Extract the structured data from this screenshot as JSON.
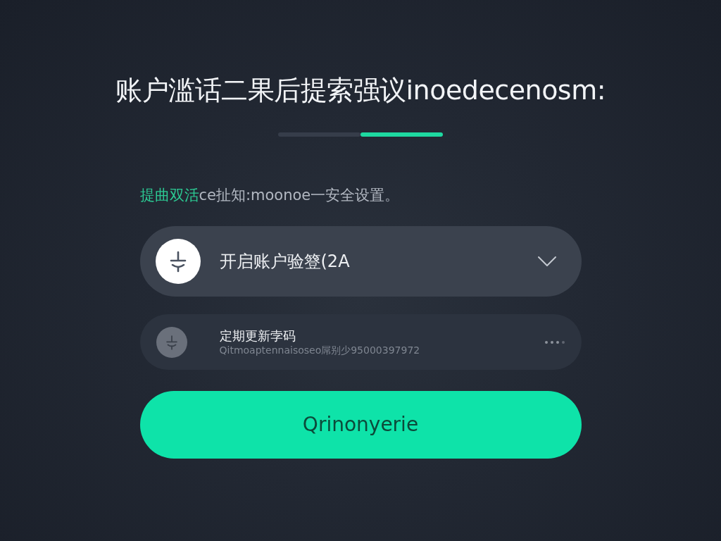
{
  "title": "账户滥话二果后提索强议inoedecenosm:",
  "steps": [
    {
      "selected": false
    },
    {
      "selected": true
    }
  ],
  "subtitle": {
    "highlight": "提曲双活",
    "text": "ce扯知:moonoe一安全设置。"
  },
  "options": [
    {
      "kind": "expandable",
      "selected": true,
      "title": "开启账户验簦(2A"
    },
    {
      "kind": "detail",
      "selected": false,
      "title": "定期更新孛码",
      "description": "Qitmoaptennaisoseo屌别少95000397972"
    }
  ],
  "button": {
    "label": "Qrinonyerie"
  }
}
